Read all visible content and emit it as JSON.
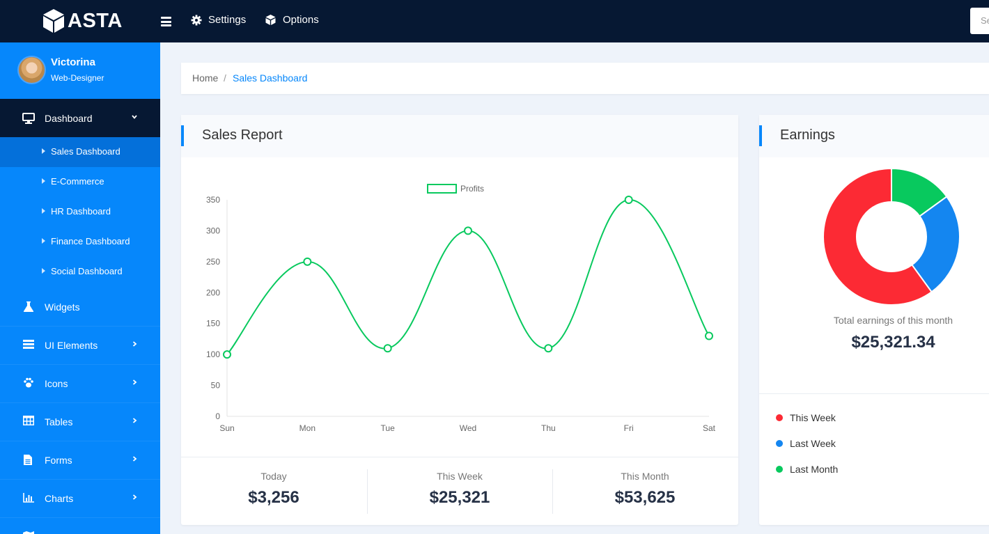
{
  "app": {
    "logo_text": "ASTA"
  },
  "topbar": {
    "settings_label": "Settings",
    "options_label": "Options",
    "search_placeholder": "Se"
  },
  "profile": {
    "name": "Victorina",
    "role": "Web-Designer"
  },
  "sidebar": {
    "dashboard_label": "Dashboard",
    "submenu": [
      {
        "label": "Sales Dashboard",
        "active": true
      },
      {
        "label": "E-Commerce"
      },
      {
        "label": "HR Dashboard"
      },
      {
        "label": "Finance Dashboard"
      },
      {
        "label": "Social Dashboard"
      }
    ],
    "items": [
      {
        "label": "Widgets",
        "icon": "flask-icon",
        "has_chevron": false
      },
      {
        "label": "UI Elements",
        "icon": "layers-icon",
        "has_chevron": true
      },
      {
        "label": "Icons",
        "icon": "paw-icon",
        "has_chevron": true
      },
      {
        "label": "Tables",
        "icon": "table-icon",
        "has_chevron": true
      },
      {
        "label": "Forms",
        "icon": "document-icon",
        "has_chevron": true
      },
      {
        "label": "Charts",
        "icon": "bar-chart-icon",
        "has_chevron": true
      }
    ]
  },
  "breadcrumb": {
    "home": "Home",
    "separator": "/",
    "current": "Sales Dashboard"
  },
  "sales_report": {
    "title": "Sales Report",
    "stats": [
      {
        "label": "Today",
        "value": "$3,256"
      },
      {
        "label": "This Week",
        "value": "$25,321"
      },
      {
        "label": "This Month",
        "value": "$53,625"
      }
    ]
  },
  "earnings": {
    "title": "Earnings",
    "caption": "Total earnings of this month",
    "total": "$25,321.34",
    "legend": [
      {
        "label": "This Week",
        "color": "#fc2a34"
      },
      {
        "label": "Last Week",
        "color": "#1486f0"
      },
      {
        "label": "Last Month",
        "color": "#08c95e"
      }
    ]
  },
  "colors": {
    "accent": "#0687fb",
    "topbar": "#061833",
    "line": "#08c95e"
  },
  "chart_data": [
    {
      "type": "line",
      "categories": [
        "Sun",
        "Mon",
        "Tue",
        "Wed",
        "Thu",
        "Fri",
        "Sat"
      ],
      "series": [
        {
          "name": "Profits",
          "values": [
            100,
            250,
            110,
            300,
            110,
            350,
            130
          ],
          "color": "#08c95e"
        }
      ],
      "ylim": [
        0,
        350
      ],
      "yticks": [
        0,
        50,
        100,
        150,
        200,
        250,
        300,
        350
      ],
      "legend": "top-center",
      "grid": false
    },
    {
      "type": "pie",
      "donut": true,
      "labels": [
        "This Week",
        "Last Week",
        "Last Month"
      ],
      "values": [
        60,
        25,
        15
      ],
      "colors": [
        "#fc2a34",
        "#1486f0",
        "#08c95e"
      ]
    }
  ]
}
